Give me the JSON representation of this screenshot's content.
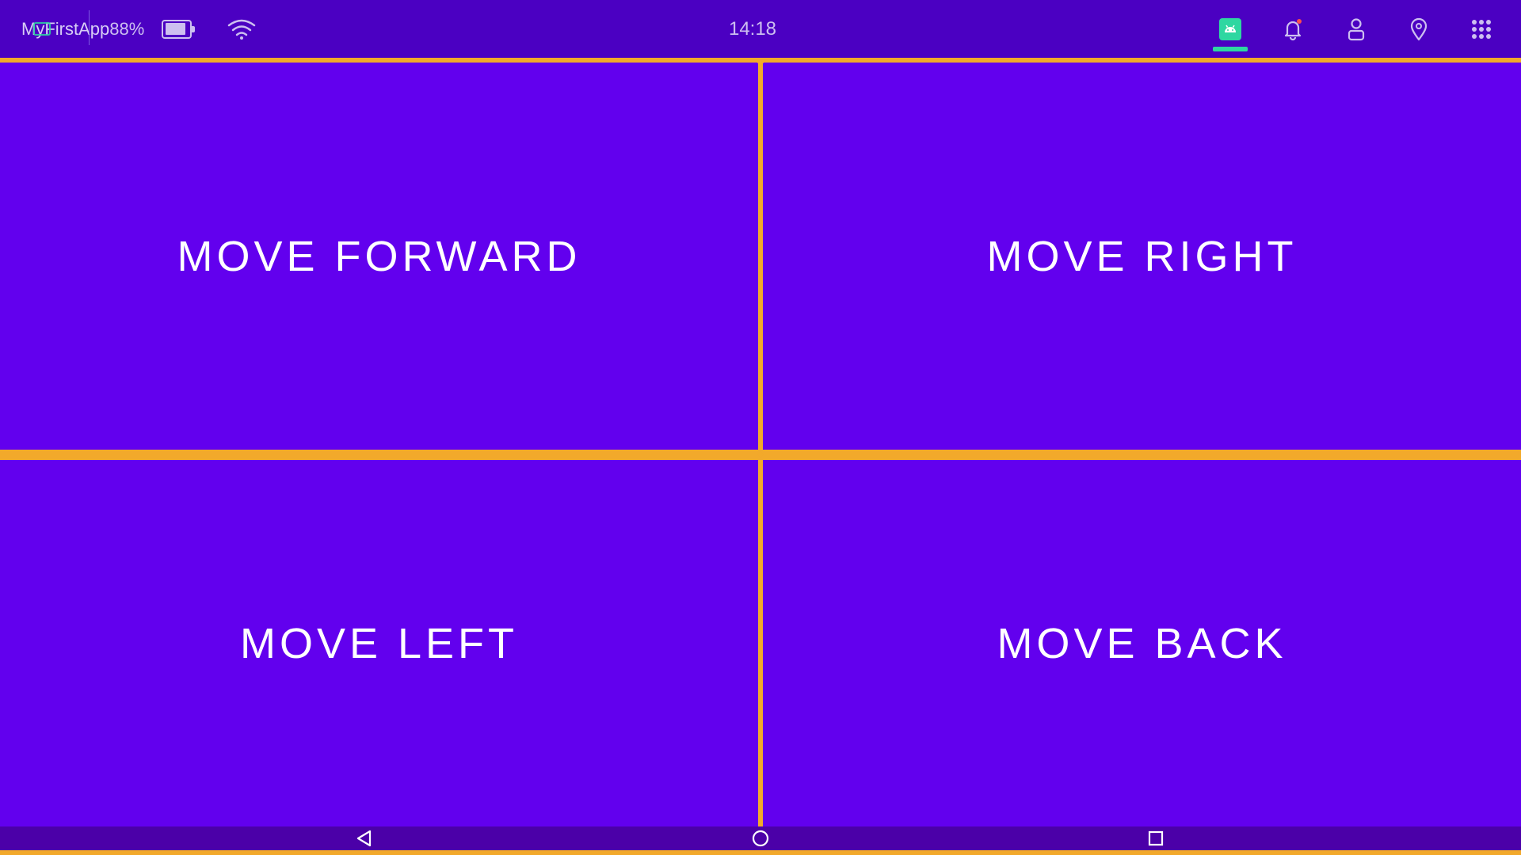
{
  "status_bar": {
    "app_name": "MyFirstApp",
    "battery_percent": "88%",
    "time": "14:18",
    "icons": [
      "battery-icon",
      "wifi-icon",
      "android-icon",
      "bell-icon",
      "user-icon",
      "location-pin-icon",
      "app-grid-icon"
    ],
    "notification_dot_color": "#ff4d4d",
    "active_indicator_color": "#2ed7a1"
  },
  "controls": {
    "forward_label": "MOVE FORWARD",
    "right_label": "MOVE RIGHT",
    "left_label": "MOVE LEFT",
    "back_label": "MOVE BACK"
  },
  "nav_bar": {
    "icons": [
      "back-triangle-icon",
      "home-circle-icon",
      "recents-square-icon"
    ]
  },
  "colors": {
    "status_bar_bg": "#4b00c2",
    "button_bg": "#6200ee",
    "divider": "#f2a92b",
    "nav_bar_bg": "#4b00a8",
    "button_text": "#ffffff"
  }
}
